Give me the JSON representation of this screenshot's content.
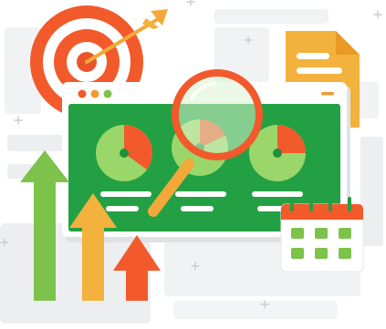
{
  "colors": {
    "background": "#ffffff",
    "ghost_shape": "#f1f2f3",
    "ghost_shape_alt": "#eceef0",
    "plus_mark": "#c9ccd1",
    "target_red": "#f25a2b",
    "target_white": "#ffffff",
    "target_center": "#e9542a",
    "dart_shaft": "#f2a93a",
    "dart_fletch": "#f2a93a",
    "document_orange": "#f3b23d",
    "document_fold": "#e99a24",
    "document_line": "#ffffff",
    "window_frame": "#ffffff",
    "window_shadow": "#dfe2e5",
    "window_dot_red": "#f25a2b",
    "window_dot_orange": "#f39a32",
    "window_dot_green": "#7cc24b",
    "window_minimize": "#f39a32",
    "dashboard_green": "#23a043",
    "dashboard_line": "#ffffff",
    "pie_light": "#9ad66a",
    "pie_red": "#f25a2b",
    "pie_center": "#1f8f3a",
    "magnifier_ring": "#f25a2b",
    "magnifier_handle": "#f2a93a",
    "magnifier_glass": "#d9f2cf",
    "calendar_red": "#f25a2b",
    "calendar_body": "#ffffff",
    "calendar_ring": "#23a043",
    "calendar_cell": "#7cc24b",
    "arrow_green": "#7cc24b",
    "arrow_orange": "#f3b23d",
    "arrow_red": "#f25a2b"
  },
  "icons": {
    "target": "target-icon",
    "dart": "dart-icon",
    "document": "document-icon",
    "browser_window": "browser-window-icon",
    "pie_chart": "pie-chart-icon",
    "magnifier": "magnifying-glass-icon",
    "calendar": "calendar-icon",
    "growth_arrows": "growth-arrows-icon"
  },
  "pie_charts": [
    {
      "red_fraction": 0.35
    },
    {
      "red_fraction": 0.18
    },
    {
      "red_fraction": 0.25
    }
  ],
  "calendar": {
    "rows": 2,
    "cols": 3
  },
  "growth_arrows": [
    {
      "color_key": "arrow_green",
      "level": 0.86
    },
    {
      "color_key": "arrow_orange",
      "level": 0.66
    },
    {
      "color_key": "arrow_red",
      "level": 0.5
    }
  ]
}
